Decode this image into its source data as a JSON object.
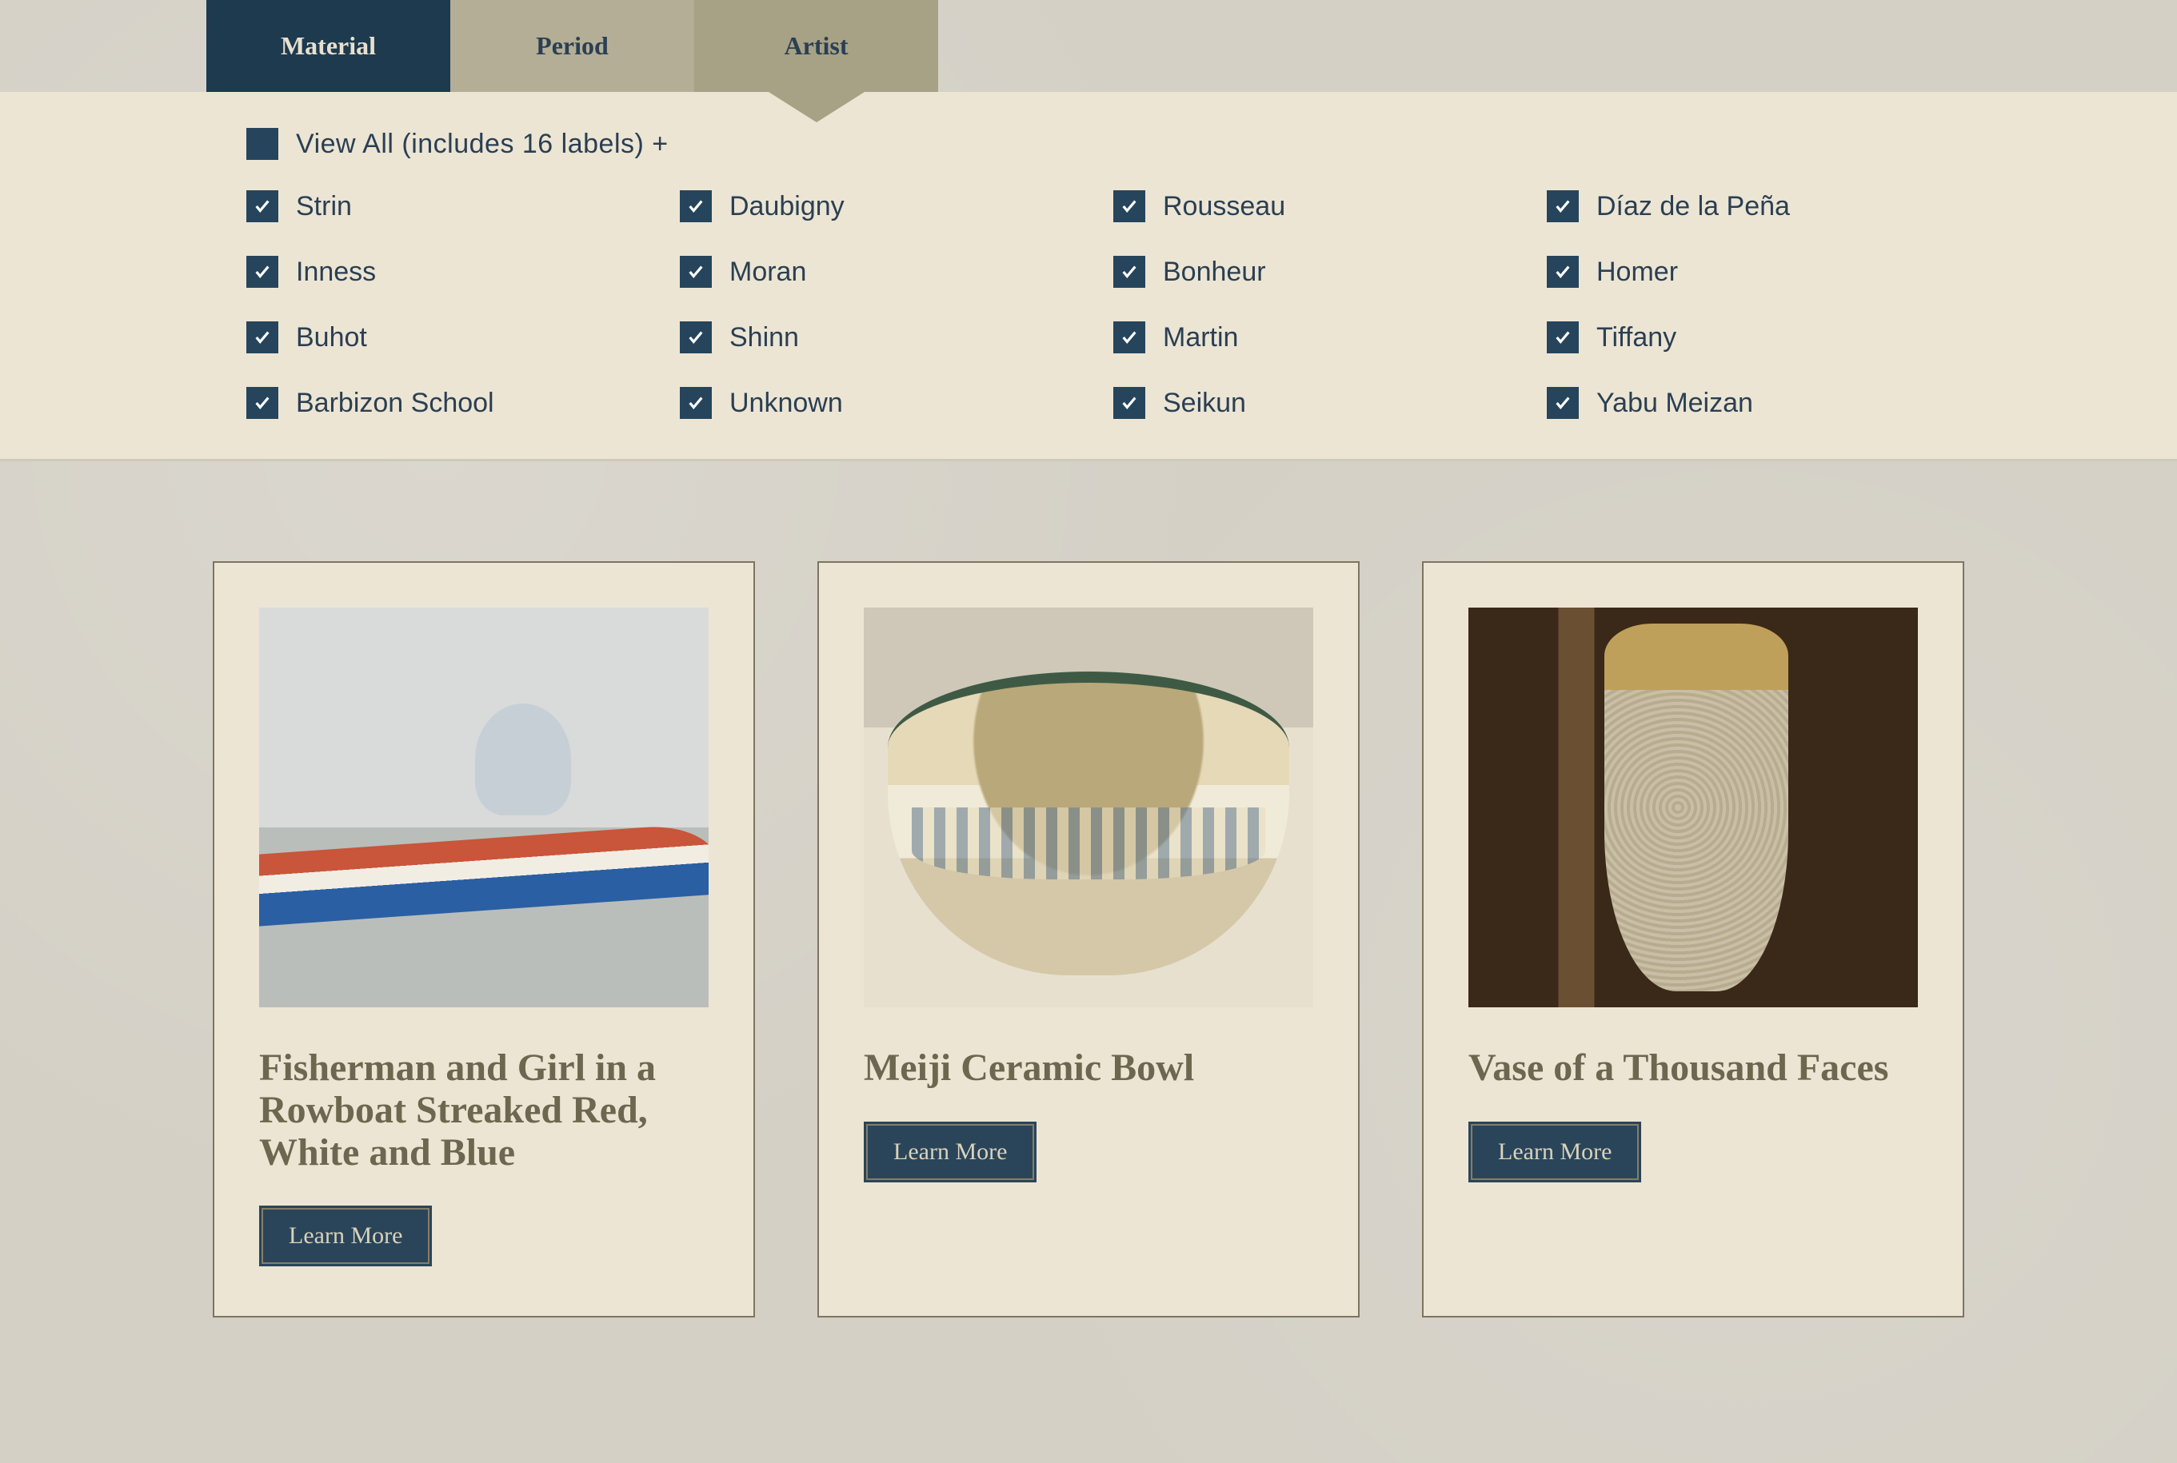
{
  "tabs": {
    "material": "Material",
    "period": "Period",
    "artist": "Artist"
  },
  "filters": {
    "view_all_label": "View All (includes 16 labels) +",
    "items": [
      {
        "label": "Strin",
        "checked": true
      },
      {
        "label": "Daubigny",
        "checked": true
      },
      {
        "label": "Rousseau",
        "checked": true
      },
      {
        "label": "Díaz de la Peña",
        "checked": true
      },
      {
        "label": "Inness",
        "checked": true
      },
      {
        "label": "Moran",
        "checked": true
      },
      {
        "label": "Bonheur",
        "checked": true
      },
      {
        "label": "Homer",
        "checked": true
      },
      {
        "label": "Buhot",
        "checked": true
      },
      {
        "label": "Shinn",
        "checked": true
      },
      {
        "label": "Martin",
        "checked": true
      },
      {
        "label": "Tiffany",
        "checked": true
      },
      {
        "label": "Barbizon School",
        "checked": true
      },
      {
        "label": "Unknown",
        "checked": true
      },
      {
        "label": "Seikun",
        "checked": true
      },
      {
        "label": "Yabu Meizan",
        "checked": true
      }
    ]
  },
  "cards": [
    {
      "title": "Fisherman and Girl in a Rowboat Streaked Red, White and Blue",
      "button": "Learn More"
    },
    {
      "title": "Meiji Ceramic Bowl",
      "button": "Learn More"
    },
    {
      "title": "Vase of a Thousand Faces",
      "button": "Learn More"
    }
  ],
  "colors": {
    "tab_active_bg": "#1d3a4f",
    "tab_inactive_bg": "#b4ae96",
    "tab_selected_bg": "#a7a185",
    "panel_bg": "#ece5d4",
    "checkbox_bg": "#26455c",
    "text_primary": "#2a3f52",
    "title_color": "#6e674f",
    "button_bg": "#2a455a"
  }
}
